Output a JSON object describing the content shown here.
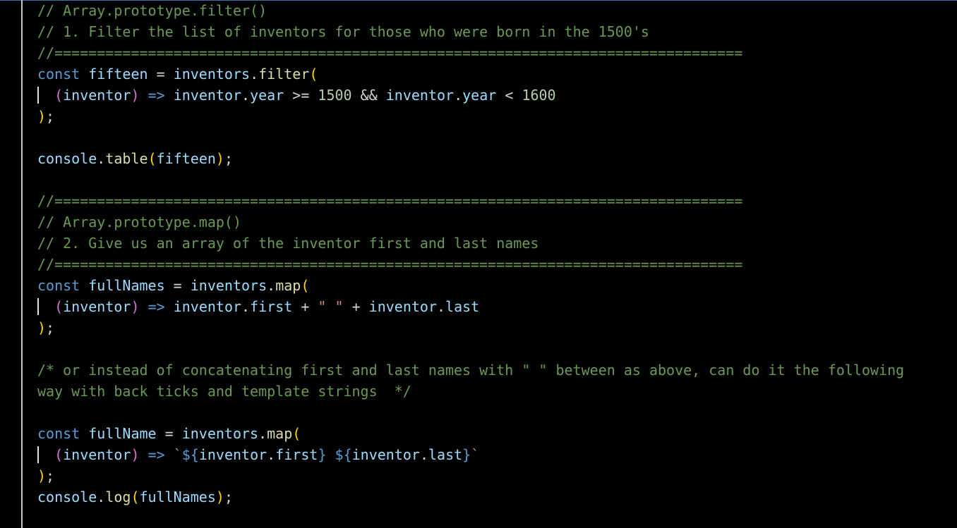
{
  "colors": {
    "background": "#000000",
    "comment": "#6a9955",
    "keyword": "#569cd6",
    "variable": "#9cdcfe",
    "function": "#dcdcaa",
    "number": "#b5cea8",
    "string": "#ce9178",
    "bracket_yellow": "#ffd700",
    "bracket_purple": "#da70d6",
    "bracket_blue": "#179fff",
    "operator": "#d4d4d4"
  },
  "code": [
    {
      "line": 1,
      "tokens": [
        {
          "t": "// Array.prototype.filter()",
          "c": "comment"
        }
      ]
    },
    {
      "line": 2,
      "tokens": [
        {
          "t": "// 1. Filter the list of inventors for those who were born in the 1500's",
          "c": "comment"
        }
      ]
    },
    {
      "line": 3,
      "tokens": [
        {
          "t": "//=================================================================================",
          "c": "comment"
        }
      ]
    },
    {
      "line": 4,
      "tokens": [
        {
          "t": "const",
          "c": "keyword"
        },
        {
          "t": " ",
          "c": "operator"
        },
        {
          "t": "fifteen",
          "c": "variable"
        },
        {
          "t": " = ",
          "c": "operator"
        },
        {
          "t": "inventors",
          "c": "variable"
        },
        {
          "t": ".",
          "c": "operator"
        },
        {
          "t": "filter",
          "c": "function"
        },
        {
          "t": "(",
          "c": "bracket_yellow"
        }
      ]
    },
    {
      "line": 5,
      "guide": true,
      "tokens": [
        {
          "t": "  ",
          "c": "operator"
        },
        {
          "t": "(",
          "c": "bracket_purple"
        },
        {
          "t": "inventor",
          "c": "variable"
        },
        {
          "t": ")",
          "c": "bracket_purple"
        },
        {
          "t": " ",
          "c": "operator"
        },
        {
          "t": "=>",
          "c": "keyword"
        },
        {
          "t": " ",
          "c": "operator"
        },
        {
          "t": "inventor",
          "c": "variable"
        },
        {
          "t": ".",
          "c": "operator"
        },
        {
          "t": "year",
          "c": "variable"
        },
        {
          "t": " >= ",
          "c": "operator"
        },
        {
          "t": "1500",
          "c": "number"
        },
        {
          "t": " && ",
          "c": "operator"
        },
        {
          "t": "inventor",
          "c": "variable"
        },
        {
          "t": ".",
          "c": "operator"
        },
        {
          "t": "year",
          "c": "variable"
        },
        {
          "t": " < ",
          "c": "operator"
        },
        {
          "t": "1600",
          "c": "number"
        }
      ]
    },
    {
      "line": 6,
      "tokens": [
        {
          "t": ")",
          "c": "bracket_yellow"
        },
        {
          "t": ";",
          "c": "operator"
        }
      ]
    },
    {
      "line": 7,
      "tokens": []
    },
    {
      "line": 8,
      "tokens": [
        {
          "t": "console",
          "c": "variable"
        },
        {
          "t": ".",
          "c": "operator"
        },
        {
          "t": "table",
          "c": "function"
        },
        {
          "t": "(",
          "c": "bracket_yellow"
        },
        {
          "t": "fifteen",
          "c": "variable"
        },
        {
          "t": ")",
          "c": "bracket_yellow"
        },
        {
          "t": ";",
          "c": "operator"
        }
      ]
    },
    {
      "line": 9,
      "tokens": []
    },
    {
      "line": 10,
      "tokens": [
        {
          "t": "//=================================================================================",
          "c": "comment"
        }
      ]
    },
    {
      "line": 11,
      "tokens": [
        {
          "t": "// Array.prototype.map()",
          "c": "comment"
        }
      ]
    },
    {
      "line": 12,
      "tokens": [
        {
          "t": "// 2. Give us an array of the inventor first and last names",
          "c": "comment"
        }
      ]
    },
    {
      "line": 13,
      "tokens": [
        {
          "t": "//=================================================================================",
          "c": "comment"
        }
      ]
    },
    {
      "line": 14,
      "tokens": [
        {
          "t": "const",
          "c": "keyword"
        },
        {
          "t": " ",
          "c": "operator"
        },
        {
          "t": "fullNames",
          "c": "variable"
        },
        {
          "t": " = ",
          "c": "operator"
        },
        {
          "t": "inventors",
          "c": "variable"
        },
        {
          "t": ".",
          "c": "operator"
        },
        {
          "t": "map",
          "c": "function"
        },
        {
          "t": "(",
          "c": "bracket_yellow"
        }
      ]
    },
    {
      "line": 15,
      "guide": true,
      "tokens": [
        {
          "t": "  ",
          "c": "operator"
        },
        {
          "t": "(",
          "c": "bracket_purple"
        },
        {
          "t": "inventor",
          "c": "variable"
        },
        {
          "t": ")",
          "c": "bracket_purple"
        },
        {
          "t": " ",
          "c": "operator"
        },
        {
          "t": "=>",
          "c": "keyword"
        },
        {
          "t": " ",
          "c": "operator"
        },
        {
          "t": "inventor",
          "c": "variable"
        },
        {
          "t": ".",
          "c": "operator"
        },
        {
          "t": "first",
          "c": "variable"
        },
        {
          "t": " + ",
          "c": "operator"
        },
        {
          "t": "\" \"",
          "c": "string"
        },
        {
          "t": " + ",
          "c": "operator"
        },
        {
          "t": "inventor",
          "c": "variable"
        },
        {
          "t": ".",
          "c": "operator"
        },
        {
          "t": "last",
          "c": "variable"
        }
      ]
    },
    {
      "line": 16,
      "tokens": [
        {
          "t": ")",
          "c": "bracket_yellow"
        },
        {
          "t": ";",
          "c": "operator"
        }
      ]
    },
    {
      "line": 17,
      "tokens": []
    },
    {
      "line": 18,
      "tokens": [
        {
          "t": "/* or instead of concatenating first and last names with \" \" between as above, can do it the following",
          "c": "comment"
        }
      ]
    },
    {
      "line": 19,
      "tokens": [
        {
          "t": "way with back ticks and template strings  */",
          "c": "comment"
        }
      ]
    },
    {
      "line": 20,
      "tokens": []
    },
    {
      "line": 21,
      "tokens": [
        {
          "t": "const",
          "c": "keyword"
        },
        {
          "t": " ",
          "c": "operator"
        },
        {
          "t": "fullName",
          "c": "variable"
        },
        {
          "t": " = ",
          "c": "operator"
        },
        {
          "t": "inventors",
          "c": "variable"
        },
        {
          "t": ".",
          "c": "operator"
        },
        {
          "t": "map",
          "c": "function"
        },
        {
          "t": "(",
          "c": "bracket_yellow"
        }
      ]
    },
    {
      "line": 22,
      "guide": true,
      "tokens": [
        {
          "t": "  ",
          "c": "operator"
        },
        {
          "t": "(",
          "c": "bracket_purple"
        },
        {
          "t": "inventor",
          "c": "variable"
        },
        {
          "t": ")",
          "c": "bracket_purple"
        },
        {
          "t": " ",
          "c": "operator"
        },
        {
          "t": "=>",
          "c": "keyword"
        },
        {
          "t": " ",
          "c": "operator"
        },
        {
          "t": "`",
          "c": "string"
        },
        {
          "t": "${",
          "c": "keyword"
        },
        {
          "t": "inventor",
          "c": "variable"
        },
        {
          "t": ".",
          "c": "operator"
        },
        {
          "t": "first",
          "c": "variable"
        },
        {
          "t": "}",
          "c": "keyword"
        },
        {
          "t": " ",
          "c": "string"
        },
        {
          "t": "${",
          "c": "keyword"
        },
        {
          "t": "inventor",
          "c": "variable"
        },
        {
          "t": ".",
          "c": "operator"
        },
        {
          "t": "last",
          "c": "variable"
        },
        {
          "t": "}",
          "c": "keyword"
        },
        {
          "t": "`",
          "c": "string"
        }
      ]
    },
    {
      "line": 23,
      "tokens": [
        {
          "t": ")",
          "c": "bracket_yellow"
        },
        {
          "t": ";",
          "c": "operator"
        }
      ]
    },
    {
      "line": 24,
      "tokens": [
        {
          "t": "console",
          "c": "variable"
        },
        {
          "t": ".",
          "c": "operator"
        },
        {
          "t": "log",
          "c": "function"
        },
        {
          "t": "(",
          "c": "bracket_yellow"
        },
        {
          "t": "fullNames",
          "c": "variable"
        },
        {
          "t": ")",
          "c": "bracket_yellow"
        },
        {
          "t": ";",
          "c": "operator"
        }
      ]
    }
  ]
}
